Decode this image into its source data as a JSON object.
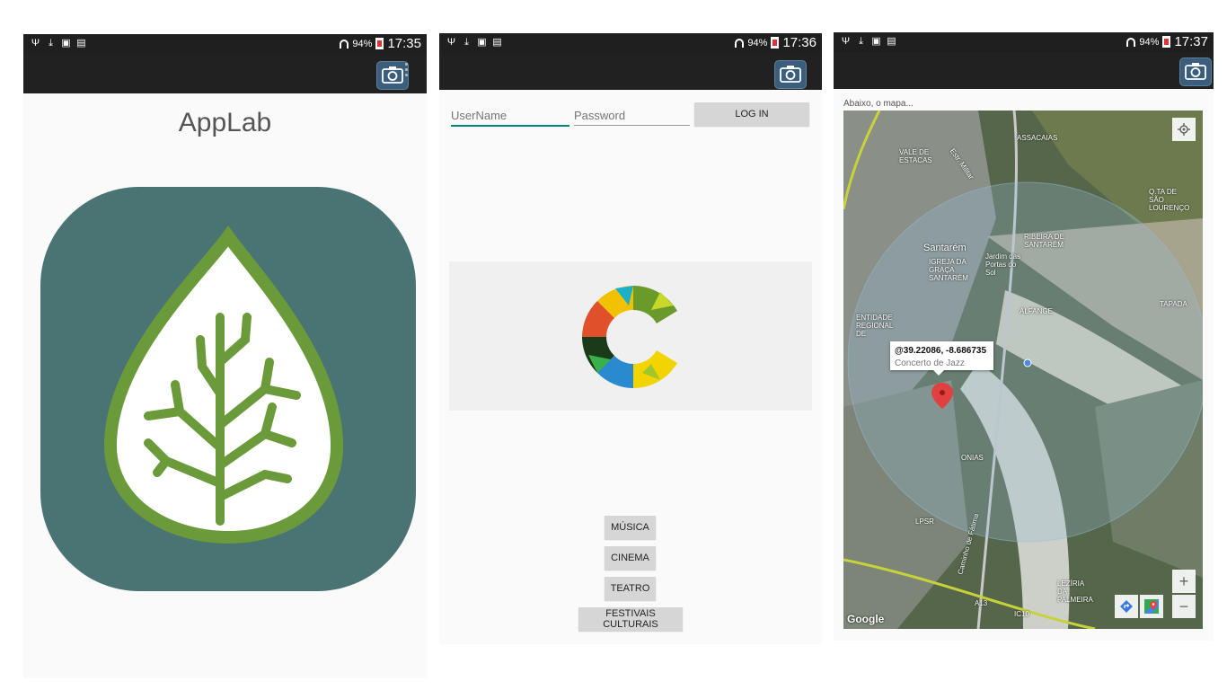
{
  "status": {
    "battery": "94%",
    "time1": "17:35",
    "time2": "17:36",
    "time3": "17:37"
  },
  "screen1": {
    "title": "AppLab",
    "logo_colors": {
      "background": "#4a7474",
      "leaf": "#6b9a3a"
    }
  },
  "screen2": {
    "username_placeholder": "UserName",
    "password_placeholder": "Password",
    "login_label": "LOG IN",
    "categories": [
      "MÚSICA",
      "CINEMA",
      "TEATRO",
      "FESTIVAIS CULTURAIS"
    ]
  },
  "screen3": {
    "caption": "Abaixo, o mapa...",
    "info_coords": "@39.22086, -8.686735",
    "info_subtitle": "Concerto de Jazz",
    "zoom_in": "+",
    "zoom_out": "−",
    "attribution": "Google",
    "place_labels": {
      "assacaias": "ASSACAIAS",
      "vale_estacas": "VALE DE ESTACAS",
      "estr_militar": "Estr. Militar",
      "qta_sao_lourenco": "Q.TA DE SÃO LOURENÇO",
      "ribeira_santarem": "RIBEIRA DE SANTARÉM",
      "santarem": "Santarém",
      "igreja_graca": "IGREJA DA GRAÇA SANTARÉM",
      "jardim_portas": "Jardim das Portas do Sol",
      "alfange": "ALFANGE",
      "tapada": "TAPADA",
      "entidade": "ENTIDADE REGIONAL DE",
      "onias": "ONIAS",
      "lpsr": "LPSR",
      "caminho_fatima": "Caminho de Fátima",
      "leziria": "LEZÍRIA DA PALMEIRA",
      "a13": "A13",
      "ic10": "IC10"
    }
  }
}
